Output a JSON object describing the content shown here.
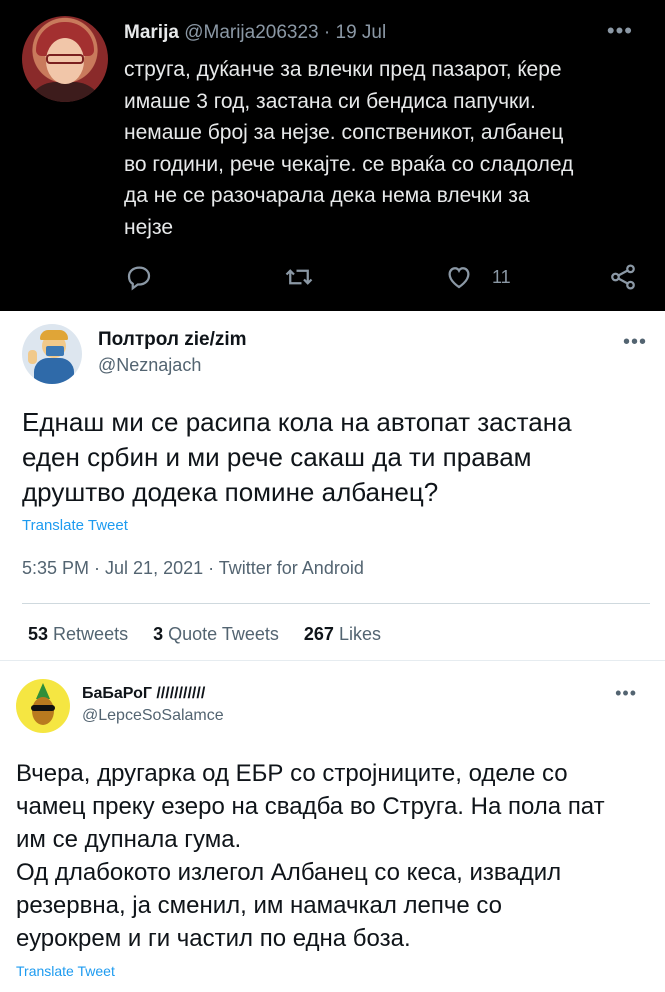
{
  "tweet1": {
    "name": "Marija",
    "handle": "@Marija206323",
    "separator": "·",
    "date": "19 Jul",
    "more": "•••",
    "text_lines": [
      "струга, дуќанче за влечки пред пазарот, ќере",
      "имаше 3 год, застана си бендиса папучки.",
      "немаше број за нејзе. сопственикот, албанец",
      "во години, рече чекајте. се враќа со сладолед",
      "да не се разочарала дека нема влечки за",
      "нејзе"
    ],
    "like_count": "11",
    "icons": [
      "reply-icon",
      "retweet-icon",
      "like-icon",
      "share-icon"
    ]
  },
  "tweet2": {
    "name": "Полтрол zie/zim",
    "handle": "@Neznajach",
    "more": "•••",
    "text_lines": [
      "Еднаш ми се расипа кола на автопат застана",
      "еден србин и ми рече сакаш да ти правам",
      "друштво додека помине албанец?"
    ],
    "translate": "Translate Tweet",
    "meta": "5:35 PM · Jul 21, 2021 · Twitter for Android",
    "stats": [
      {
        "count": "53",
        "label": "Retweets"
      },
      {
        "count": "3",
        "label": "Quote Tweets"
      },
      {
        "count": "267",
        "label": "Likes"
      }
    ]
  },
  "tweet3": {
    "name": "БаБаРоГ ///////////",
    "handle": "@LepceSoSalamce",
    "more": "•••",
    "text_lines": [
      "Вчера, другарка од ЕБР со стројниците, оделе со",
      "чамец преку езеро на свадба во Струга. На пола пат",
      "им се дупнала гума.",
      "Од длабокото излегол Албанец со кеса, извадил",
      "резервна, ја сменил, им намачкал лепче со",
      "еурокрем и ги частил по една боза."
    ],
    "translate": "Translate Tweet"
  },
  "colors": {
    "dark_bg": "#000000",
    "dark_text": "#e7e9ea",
    "muted": "#8b98a5",
    "link": "#1d9bf0"
  }
}
